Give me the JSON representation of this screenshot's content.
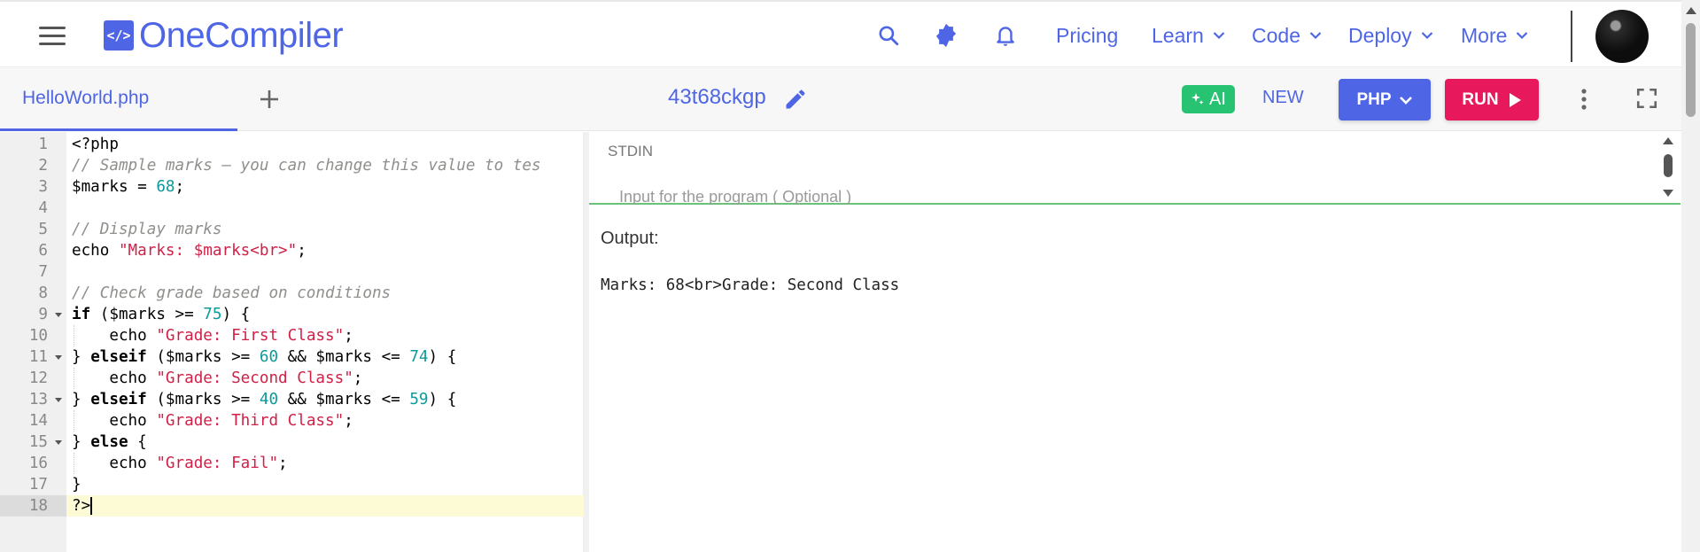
{
  "header": {
    "logo_symbol": "</>",
    "logo_text": "OneCompiler",
    "icons": [
      "menu-icon",
      "search-icon",
      "theme-toggle-icon",
      "notification-bell-icon"
    ],
    "nav": [
      {
        "label": "Pricing",
        "dropdown": false
      },
      {
        "label": "Learn",
        "dropdown": true
      },
      {
        "label": "Code",
        "dropdown": true
      },
      {
        "label": "Deploy",
        "dropdown": true
      },
      {
        "label": "More",
        "dropdown": true
      }
    ],
    "accent_color": "#4e66e6"
  },
  "toolbar": {
    "file_tab": "HelloWorld.php",
    "code_id": "43t68ckgp",
    "ai_label": "AI",
    "new_label": "NEW",
    "language_label": "PHP",
    "run_label": "RUN",
    "colors": {
      "ai": "#27c272",
      "language": "#4e66e6",
      "run": "#e8185c"
    }
  },
  "editor": {
    "active_line": 18,
    "lines": [
      {
        "n": "1",
        "code": "<?php"
      },
      {
        "n": "2",
        "code": "// Sample marks — you can change this value to tes"
      },
      {
        "n": "3",
        "code": "$marks = 68;"
      },
      {
        "n": "4",
        "code": ""
      },
      {
        "n": "5",
        "code": "// Display marks"
      },
      {
        "n": "6",
        "code": "echo \"Marks: $marks<br>\";"
      },
      {
        "n": "7",
        "code": ""
      },
      {
        "n": "8",
        "code": "// Check grade based on conditions"
      },
      {
        "n": "9",
        "code": "if ($marks >= 75) {",
        "fold": true
      },
      {
        "n": "10",
        "code": "    echo \"Grade: First Class\";"
      },
      {
        "n": "11",
        "code": "} elseif ($marks >= 60 && $marks <= 74) {",
        "fold": true
      },
      {
        "n": "12",
        "code": "    echo \"Grade: Second Class\";"
      },
      {
        "n": "13",
        "code": "} elseif ($marks >= 40 && $marks <= 59) {",
        "fold": true
      },
      {
        "n": "14",
        "code": "    echo \"Grade: Third Class\";"
      },
      {
        "n": "15",
        "code": "} else {",
        "fold": true
      },
      {
        "n": "16",
        "code": "    echo \"Grade: Fail\";"
      },
      {
        "n": "17",
        "code": "}"
      },
      {
        "n": "18",
        "code": "?>"
      }
    ]
  },
  "stdin": {
    "label": "STDIN",
    "placeholder": "Input for the program ( Optional )"
  },
  "output": {
    "label": "Output:",
    "text": "Marks: 68<br>Grade: Second Class"
  }
}
